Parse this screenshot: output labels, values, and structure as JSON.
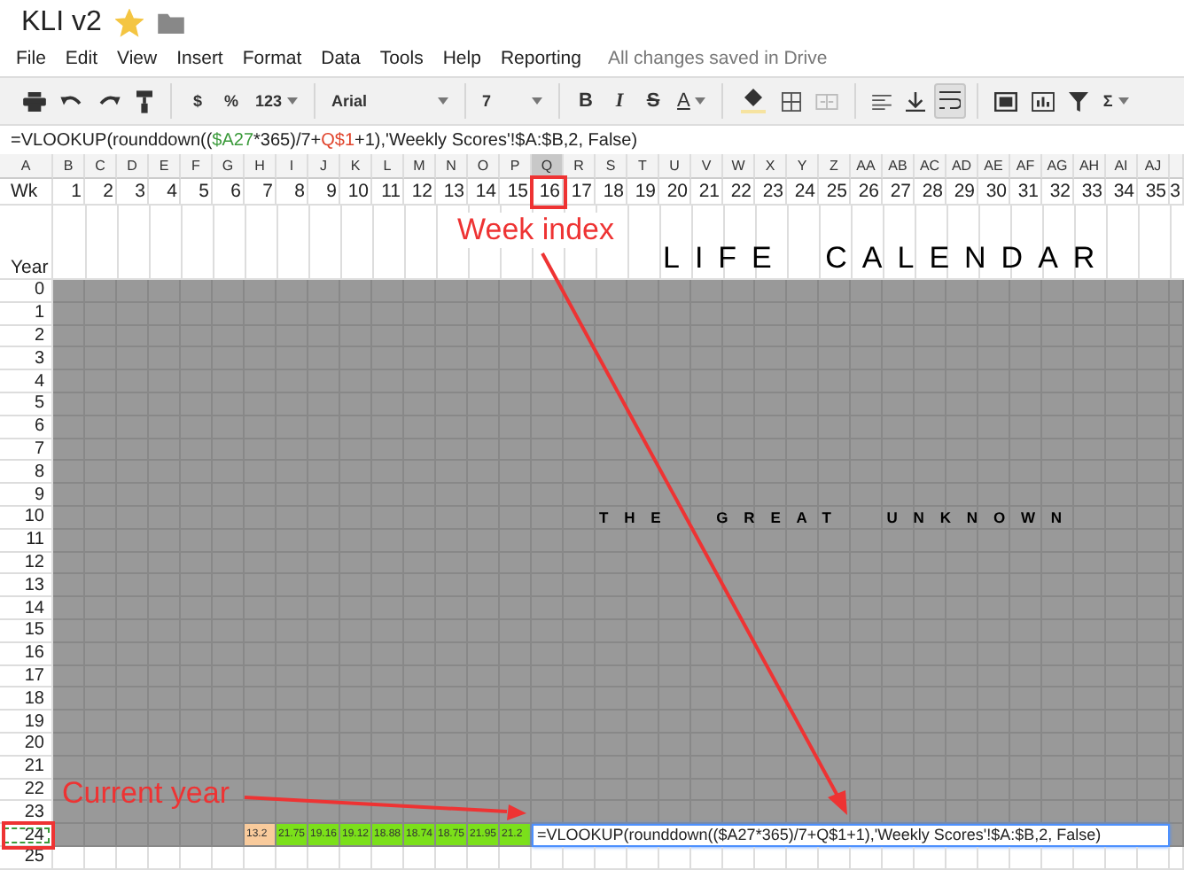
{
  "document": {
    "title": "KLI v2",
    "starred": true
  },
  "menu": [
    "File",
    "Edit",
    "View",
    "Insert",
    "Format",
    "Data",
    "Tools",
    "Help",
    "Reporting"
  ],
  "save_status": "All changes saved in Drive",
  "toolbar": {
    "currency": "$",
    "percent": "%",
    "number_format": "123",
    "font": "Arial",
    "font_size": "7",
    "bold": "B",
    "italic": "I",
    "strikethrough": "S",
    "text_color": "A",
    "functions": "Σ",
    "wrap_selected": true
  },
  "formula_bar": [
    {
      "text": "=VLOOKUP(rounddown((",
      "color": "#222222"
    },
    {
      "text": "$A27",
      "color": "#3a9a3a"
    },
    {
      "text": "*365)/7+",
      "color": "#222222"
    },
    {
      "text": "Q$1",
      "color": "#e0442c"
    },
    {
      "text": "+1),'Weekly Scores'!$A:$B,2, False)",
      "color": "#222222"
    }
  ],
  "sheet": {
    "columns": [
      {
        "letter": "A",
        "selected": false
      },
      {
        "letter": "B",
        "selected": false
      },
      {
        "letter": "C",
        "selected": false
      },
      {
        "letter": "D",
        "selected": false
      },
      {
        "letter": "E",
        "selected": false
      },
      {
        "letter": "F",
        "selected": false
      },
      {
        "letter": "G",
        "selected": false
      },
      {
        "letter": "H",
        "selected": false
      },
      {
        "letter": "I",
        "selected": false
      },
      {
        "letter": "J",
        "selected": false
      },
      {
        "letter": "K",
        "selected": false
      },
      {
        "letter": "L",
        "selected": false
      },
      {
        "letter": "M",
        "selected": false
      },
      {
        "letter": "N",
        "selected": false
      },
      {
        "letter": "O",
        "selected": false
      },
      {
        "letter": "P",
        "selected": false
      },
      {
        "letter": "Q",
        "selected": true
      },
      {
        "letter": "R",
        "selected": false
      },
      {
        "letter": "S",
        "selected": false
      },
      {
        "letter": "T",
        "selected": false
      },
      {
        "letter": "U",
        "selected": false
      },
      {
        "letter": "V",
        "selected": false
      },
      {
        "letter": "W",
        "selected": false
      },
      {
        "letter": "X",
        "selected": false
      },
      {
        "letter": "Y",
        "selected": false
      },
      {
        "letter": "Z",
        "selected": false
      },
      {
        "letter": "AA",
        "selected": false
      },
      {
        "letter": "AB",
        "selected": false
      },
      {
        "letter": "AC",
        "selected": false
      },
      {
        "letter": "AD",
        "selected": false
      },
      {
        "letter": "AE",
        "selected": false
      },
      {
        "letter": "AF",
        "selected": false
      },
      {
        "letter": "AG",
        "selected": false
      },
      {
        "letter": "AH",
        "selected": false
      },
      {
        "letter": "AI",
        "selected": false
      },
      {
        "letter": "AJ",
        "selected": false
      }
    ],
    "week_row": [
      "Wk",
      "1",
      "2",
      "3",
      "4",
      "5",
      "6",
      "7",
      "8",
      "9",
      "10",
      "11",
      "12",
      "13",
      "14",
      "15",
      "16",
      "17",
      "18",
      "19",
      "20",
      "21",
      "22",
      "23",
      "24",
      "25",
      "26",
      "27",
      "28",
      "29",
      "30",
      "31",
      "32",
      "33",
      "34",
      "35",
      "3"
    ],
    "year_label": "Year",
    "title_banner": "LIFE CALENDAR",
    "rows": [
      {
        "label": "0",
        "selected": false,
        "shaded": true
      },
      {
        "label": "1",
        "selected": false,
        "shaded": true
      },
      {
        "label": "2",
        "selected": false,
        "shaded": true
      },
      {
        "label": "3",
        "selected": false,
        "shaded": true
      },
      {
        "label": "4",
        "selected": false,
        "shaded": true
      },
      {
        "label": "5",
        "selected": false,
        "shaded": true
      },
      {
        "label": "6",
        "selected": false,
        "shaded": true
      },
      {
        "label": "7",
        "selected": false,
        "shaded": true
      },
      {
        "label": "8",
        "selected": false,
        "shaded": true
      },
      {
        "label": "9",
        "selected": false,
        "shaded": true
      },
      {
        "label": "10",
        "selected": false,
        "shaded": true,
        "banner": "THE GREAT UNKNOWN"
      },
      {
        "label": "11",
        "selected": false,
        "shaded": true
      },
      {
        "label": "12",
        "selected": false,
        "shaded": true
      },
      {
        "label": "13",
        "selected": false,
        "shaded": true
      },
      {
        "label": "14",
        "selected": false,
        "shaded": true
      },
      {
        "label": "15",
        "selected": false,
        "shaded": true
      },
      {
        "label": "16",
        "selected": false,
        "shaded": true
      },
      {
        "label": "17",
        "selected": false,
        "shaded": true
      },
      {
        "label": "18",
        "selected": false,
        "shaded": true
      },
      {
        "label": "19",
        "selected": false,
        "shaded": true
      },
      {
        "label": "20",
        "selected": false,
        "shaded": true
      },
      {
        "label": "21",
        "selected": false,
        "shaded": true
      },
      {
        "label": "22",
        "selected": false,
        "shaded": true
      },
      {
        "label": "23",
        "selected": false,
        "shaded": true
      },
      {
        "label": "24",
        "selected": true,
        "shaded": true,
        "cells": [
          {
            "kind": "blank"
          },
          {
            "kind": "blank"
          },
          {
            "kind": "blank"
          },
          {
            "kind": "blank"
          },
          {
            "kind": "blank"
          },
          {
            "kind": "blank"
          },
          {
            "kind": "value",
            "text": "13.2",
            "color": "#f9cb9c"
          },
          {
            "kind": "value",
            "text": "21.75",
            "color": "#7be01a"
          },
          {
            "kind": "value",
            "text": "19.16",
            "color": "#7be01a"
          },
          {
            "kind": "value",
            "text": "19.12",
            "color": "#7be01a"
          },
          {
            "kind": "value",
            "text": "18.88",
            "color": "#7be01a"
          },
          {
            "kind": "value",
            "text": "18.74",
            "color": "#7be01a"
          },
          {
            "kind": "value",
            "text": "18.75",
            "color": "#7be01a"
          },
          {
            "kind": "value",
            "text": "21.95",
            "color": "#7be01a"
          },
          {
            "kind": "value",
            "text": "21.2",
            "color": "#7be01a"
          },
          {
            "kind": "editor",
            "text": "=VLOOKUP(rounddown(($A27*365)/7+Q$1+1),'Weekly Scores'!$A:$B,2, False)"
          }
        ]
      },
      {
        "label": "25",
        "selected": false,
        "shaded": false
      }
    ]
  },
  "annotations": [
    {
      "kind": "column",
      "text": "Week index"
    },
    {
      "kind": "row",
      "text": "Current year"
    }
  ]
}
